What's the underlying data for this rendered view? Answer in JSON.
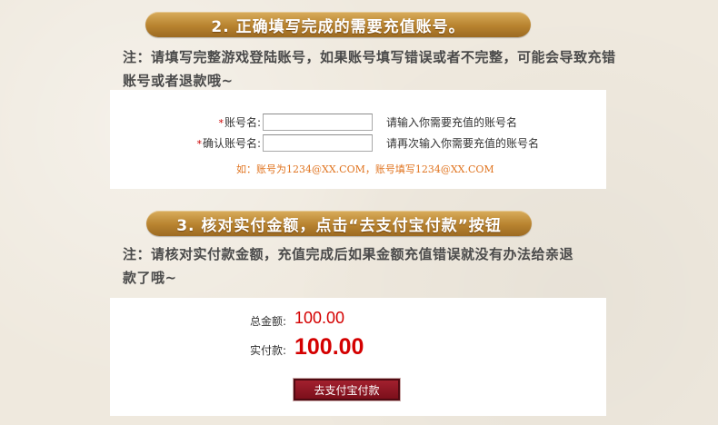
{
  "section2": {
    "title": "2. 正确填写完成的需要充值账号。",
    "note_line1": "注：请填写完整游戏登陆账号，如果账号填写错误或者不完整，可能会导致充错",
    "note_line2": "账号或者退款哦~"
  },
  "account_form": {
    "required_mark": "*",
    "account_label": "账号名:",
    "account_value": "",
    "account_hint": "请输入你需要充值的账号名",
    "confirm_label": "确认账号名:",
    "confirm_value": "",
    "confirm_hint": "请再次输入你需要充值的账号名",
    "example": "如：账号为1234@XX.COM，账号填写1234@XX.COM"
  },
  "section3": {
    "title": "3. 核对实付金额，点击“去支付宝付款”按钮",
    "note_line1": "注：请核对实付款金额，充值完成后如果金额充值错误就没有办法给亲退",
    "note_line2": "款了哦~"
  },
  "payment": {
    "total_label": "总金额:",
    "total_value": "100.00",
    "actual_label": "实付款:",
    "actual_value": "100.00",
    "pay_button": "去支付宝付款"
  },
  "colors": {
    "banner_gold": "#b8832f",
    "amount_red": "#d40000",
    "example_orange": "#e0731e",
    "pay_button_red": "#8c1220"
  }
}
